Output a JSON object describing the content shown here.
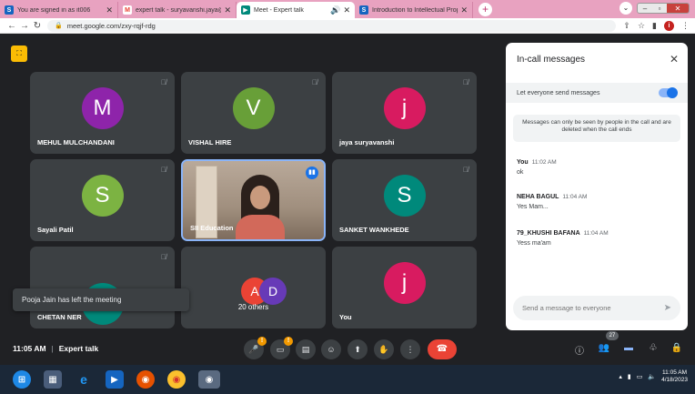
{
  "browser": {
    "tabs": [
      {
        "title": "You are signed in as it006",
        "fav": "S",
        "fav_color": "#1565c0"
      },
      {
        "title": "expert talk - suryavanshi.jaya@k",
        "fav": "M",
        "fav_color": "#ea4335"
      },
      {
        "title": "Meet - Expert talk",
        "fav": "▶",
        "fav_color": "#00897b",
        "active": true
      },
      {
        "title": "Introduction to Intellectual Prope",
        "fav": "S",
        "fav_color": "#1565c0"
      }
    ],
    "url": "meet.google.com/zxy-rqjf-rdg",
    "profile_initial": "i"
  },
  "meet": {
    "tiles": [
      {
        "name": "MEHUL MULCHANDANI",
        "initial": "M",
        "color": "#8e24aa"
      },
      {
        "name": "VISHAL HIRE",
        "initial": "V",
        "color": "#689f38"
      },
      {
        "name": "jaya suryavanshi",
        "initial": "j",
        "color": "#d81b60"
      },
      {
        "name": "Sayali Patil",
        "initial": "S",
        "color": "#7cb342"
      },
      {
        "name": "SII Education",
        "initial": "",
        "color": "#8c7d6f"
      },
      {
        "name": "SANKET WANKHEDE",
        "initial": "S",
        "color": "#00897b"
      },
      {
        "name": "CHETAN NER",
        "initial": "C",
        "color": "#00897b"
      },
      {
        "name": "20 others",
        "initial": "",
        "color": ""
      },
      {
        "name": "You",
        "initial": "j",
        "color": "#d81b60"
      }
    ],
    "others_avatars": [
      "A",
      "D"
    ],
    "toast": "Pooja Jain has left the meeting",
    "time": "11:05 AM",
    "meeting_name": "Expert talk",
    "people_count": "27",
    "mic_badge": "!",
    "cam_badge": "!"
  },
  "chat": {
    "title": "In-call messages",
    "toggle_label": "Let everyone send messages",
    "toggle_on": true,
    "note": "Messages can only be seen by people in the call and are deleted when the call ends",
    "messages": [
      {
        "sender": "You",
        "time": "11:02 AM",
        "text": "ok"
      },
      {
        "sender": "NEHA BAGUL",
        "time": "11:04 AM",
        "text": "Yes Mam..."
      },
      {
        "sender": "79_KHUSHI BAFANA",
        "time": "11:04 AM",
        "text": "Yess ma'am"
      }
    ],
    "placeholder": "Send a message to everyone"
  },
  "taskbar": {
    "time": "11:05 AM",
    "date": "4/18/2023"
  },
  "colors": {
    "meet_bg": "#202124",
    "tile_bg": "#3c4043",
    "accent": "#1a73e8",
    "end_call": "#ea4335",
    "tab_strip": "#e8a2c0"
  }
}
